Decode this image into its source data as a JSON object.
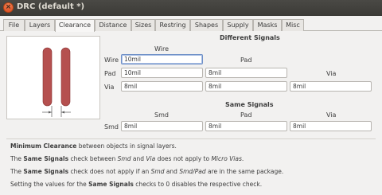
{
  "window": {
    "title": "DRC (default *)",
    "close_glyph": "×"
  },
  "tabs": [
    "File",
    "Layers",
    "Clearance",
    "Distance",
    "Sizes",
    "Restring",
    "Shapes",
    "Supply",
    "Masks",
    "Misc"
  ],
  "active_tab": "Clearance",
  "different_signals": {
    "heading": "Different Signals",
    "col_wire": "Wire",
    "col_pad": "Pad",
    "col_via": "Via",
    "row_wire_label": "Wire",
    "row_pad_label": "Pad",
    "row_via_label": "Via",
    "wire_wire": "10mil",
    "pad_wire": "10mil",
    "pad_pad": "8mil",
    "via_wire": "8mil",
    "via_pad": "8mil",
    "via_via": "8mil"
  },
  "same_signals": {
    "heading": "Same Signals",
    "col_smd": "Smd",
    "col_pad": "Pad",
    "col_via": "Via",
    "row_smd_label": "Smd",
    "smd_smd": "8mil",
    "smd_pad": "8mil",
    "smd_via": "8mil"
  },
  "help": {
    "line1_bold": "Minimum Clearance",
    "line1_rest": " between objects in signal layers.",
    "line2_a": "The ",
    "line2_b": "Same Signals",
    "line2_c": " check between ",
    "line2_d": "Smd",
    "line2_e": " and ",
    "line2_f": "Via",
    "line2_g": " does not apply to ",
    "line2_h": "Micro Vias",
    "line2_i": ".",
    "line3_a": "The ",
    "line3_b": "Same Signals",
    "line3_c": " check does not apply if an ",
    "line3_d": "Smd",
    "line3_e": " and ",
    "line3_f": "Smd/Pad",
    "line3_g": " are in the same package.",
    "line4_a": "Setting the values for the ",
    "line4_b": "Same Signals",
    "line4_c": " checks to 0 disables the respective check."
  },
  "colors": {
    "trace": "#b5504f",
    "trace_outline": "#8a3434"
  }
}
